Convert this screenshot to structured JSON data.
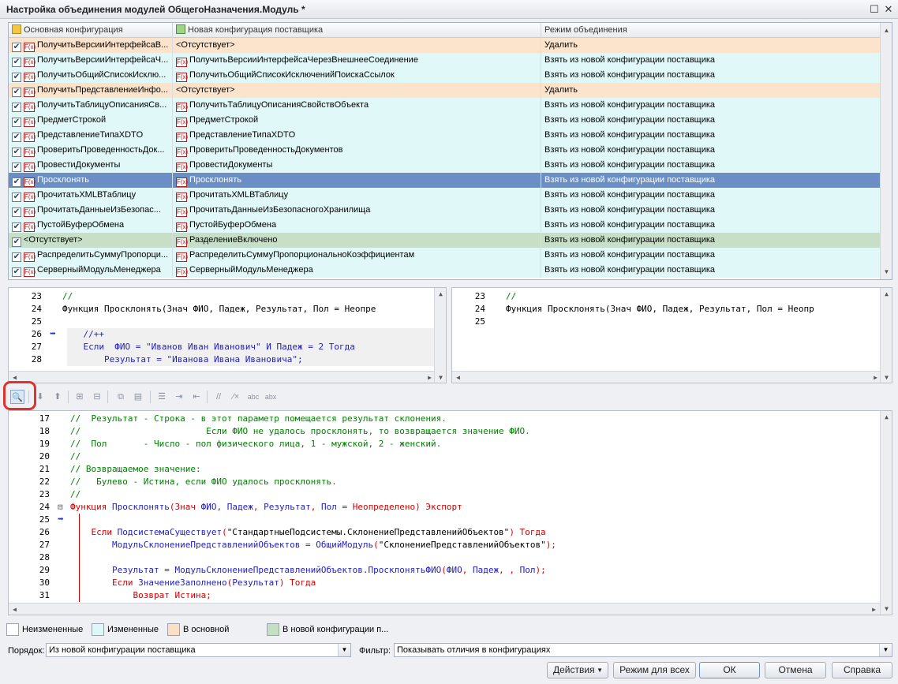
{
  "window": {
    "title": "Настройка объединения модулей ОбщегоНазначения.Модуль *",
    "maximize_glyph": "☐",
    "close_glyph": "✕"
  },
  "grid": {
    "columns": [
      "Основная конфигурация",
      "Новая конфигурация поставщика",
      "Режим объединения"
    ],
    "rows": [
      {
        "main": "ПолучитьВерсииИнтерфейсаВ...",
        "main_fx": true,
        "new": "<Отсутствует>",
        "new_fx": false,
        "mode": "Удалить",
        "state": "main"
      },
      {
        "main": "ПолучитьВерсииИнтерфейсаЧ...",
        "main_fx": true,
        "new": "ПолучитьВерсииИнтерфейсаЧерезВнешнееСоединение",
        "new_fx": true,
        "mode": "Взять из новой конфигурации поставщика",
        "state": "changed"
      },
      {
        "main": "ПолучитьОбщийСписокИсклю...",
        "main_fx": true,
        "new": "ПолучитьОбщийСписокИсключенийПоискаСсылок",
        "new_fx": true,
        "mode": "Взять из новой конфигурации поставщика",
        "state": "changed"
      },
      {
        "main": "ПолучитьПредставлениеИнфо...",
        "main_fx": true,
        "new": "<Отсутствует>",
        "new_fx": false,
        "mode": "Удалить",
        "state": "main"
      },
      {
        "main": "ПолучитьТаблицуОписанияСв...",
        "main_fx": true,
        "new": "ПолучитьТаблицуОписанияСвойствОбъекта",
        "new_fx": true,
        "mode": "Взять из новой конфигурации поставщика",
        "state": "changed"
      },
      {
        "main": "ПредметСтрокой",
        "main_fx": true,
        "new": "ПредметСтрокой",
        "new_fx": true,
        "mode": "Взять из новой конфигурации поставщика",
        "state": "changed"
      },
      {
        "main": "ПредставлениеТипаXDTO",
        "main_fx": true,
        "new": "ПредставлениеТипаXDTO",
        "new_fx": true,
        "mode": "Взять из новой конфигурации поставщика",
        "state": "changed"
      },
      {
        "main": "ПроверитьПроведенностьДок...",
        "main_fx": true,
        "new": "ПроверитьПроведенностьДокументов",
        "new_fx": true,
        "mode": "Взять из новой конфигурации поставщика",
        "state": "changed"
      },
      {
        "main": "ПровестиДокументы",
        "main_fx": true,
        "new": "ПровестиДокументы",
        "new_fx": true,
        "mode": "Взять из новой конфигурации поставщика",
        "state": "changed"
      },
      {
        "main": "Просклонять",
        "main_fx": true,
        "new": "Просклонять",
        "new_fx": true,
        "mode": "Взять из новой конфигурации поставщика",
        "state": "selected"
      },
      {
        "main": "ПрочитатьXMLВТаблицу",
        "main_fx": true,
        "new": "ПрочитатьXMLВТаблицу",
        "new_fx": true,
        "mode": "Взять из новой конфигурации поставщика",
        "state": "changed"
      },
      {
        "main": "ПрочитатьДанныеИзБезопас...",
        "main_fx": true,
        "new": "ПрочитатьДанныеИзБезопасногоХранилища",
        "new_fx": true,
        "mode": "Взять из новой конфигурации поставщика",
        "state": "changed"
      },
      {
        "main": "ПустойБуферОбмена",
        "main_fx": true,
        "new": "ПустойБуферОбмена",
        "new_fx": true,
        "mode": "Взять из новой конфигурации поставщика",
        "state": "changed"
      },
      {
        "main": "<Отсутствует>",
        "main_fx": false,
        "new": "РазделениеВключено",
        "new_fx": true,
        "mode": "Взять из новой конфигурации поставщика",
        "state": "new"
      },
      {
        "main": "РаспределитьСуммуПропорци...",
        "main_fx": true,
        "new": "РаспределитьСуммуПропорциональноКоэффициентам",
        "new_fx": true,
        "mode": "Взять из новой конфигурации поставщика",
        "state": "changed"
      },
      {
        "main": "СерверныйМодульМенеджера",
        "main_fx": true,
        "new": "СерверныйМодульМенеджера",
        "new_fx": true,
        "mode": "Взять из новой конфигурации поставщика",
        "state": "changed"
      }
    ]
  },
  "left_pane": [
    {
      "n": "23",
      "parts": [
        {
          "t": "//",
          "c": "cm"
        }
      ]
    },
    {
      "n": "24",
      "parts": [
        {
          "t": "Функция Просклонять(Знач ФИО, Падеж, Результат, Пол = Неопре",
          "c": "st"
        }
      ]
    },
    {
      "n": "25",
      "parts": []
    },
    {
      "n": "26",
      "parts": [
        {
          "t": "    //++",
          "c": "bl"
        }
      ],
      "arrow": true
    },
    {
      "n": "27",
      "parts": [
        {
          "t": "    Если  ФИО = \"Иванов Иван Иванович\" И Падеж = 2 Тогда",
          "c": "bl"
        }
      ]
    },
    {
      "n": "28",
      "parts": [
        {
          "t": "        Результат = \"Иванова Ивана Ивановича\";",
          "c": "bl"
        }
      ]
    }
  ],
  "right_pane": [
    {
      "n": "23",
      "parts": [
        {
          "t": "//",
          "c": "cm"
        }
      ]
    },
    {
      "n": "24",
      "parts": [
        {
          "t": "Функция Просклонять(Знач ФИО, Падеж, Результат, Пол = Неопр",
          "c": "st"
        }
      ]
    },
    {
      "n": "25",
      "parts": []
    }
  ],
  "code": [
    {
      "n": "17",
      "parts": [
        {
          "t": "//  Результат - Строка - в этот параметр помещается результат склонения.",
          "c": "cm"
        }
      ]
    },
    {
      "n": "18",
      "parts": [
        {
          "t": "//                        Если ФИО не удалось просклонять, то возвращается значение ФИО.",
          "c": "cm"
        }
      ]
    },
    {
      "n": "19",
      "parts": [
        {
          "t": "//  Пол       - Число - пол физического лица, 1 - мужской, 2 - женский.",
          "c": "cm"
        }
      ]
    },
    {
      "n": "20",
      "parts": [
        {
          "t": "//",
          "c": "cm"
        }
      ]
    },
    {
      "n": "21",
      "parts": [
        {
          "t": "// Возвращаемое значение:",
          "c": "cm"
        }
      ]
    },
    {
      "n": "22",
      "parts": [
        {
          "t": "//   Булево - Истина, если ФИО удалось просклонять.",
          "c": "cm"
        }
      ]
    },
    {
      "n": "23",
      "parts": [
        {
          "t": "//",
          "c": "cm"
        }
      ]
    },
    {
      "n": "24",
      "fold": true,
      "parts": [
        {
          "t": "Функция ",
          "c": "kw"
        },
        {
          "t": "Просклонять",
          "c": "bl"
        },
        {
          "t": "(",
          "c": "kw"
        },
        {
          "t": "Знач ",
          "c": "kw"
        },
        {
          "t": "ФИО",
          "c": "bl"
        },
        {
          "t": ", ",
          "c": "kw"
        },
        {
          "t": "Падеж",
          "c": "bl"
        },
        {
          "t": ", ",
          "c": "kw"
        },
        {
          "t": "Результат",
          "c": "bl"
        },
        {
          "t": ", ",
          "c": "kw"
        },
        {
          "t": "Пол",
          "c": "bl"
        },
        {
          "t": " = Неопределено) Экспорт",
          "c": "kw"
        }
      ]
    },
    {
      "n": "25",
      "arrow": true,
      "parts": []
    },
    {
      "n": "26",
      "parts": [
        {
          "t": "    Если ",
          "c": "kw"
        },
        {
          "t": "ПодсистемаСуществует",
          "c": "bl"
        },
        {
          "t": "(",
          "c": "kw"
        },
        {
          "t": "\"СтандартныеПодсистемы.СклонениеПредставленийОбъектов\"",
          "c": "st"
        },
        {
          "t": ") Тогда",
          "c": "kw"
        }
      ]
    },
    {
      "n": "27",
      "parts": [
        {
          "t": "        МодульСклонениеПредставленийОбъектов",
          "c": "bl"
        },
        {
          "t": " = ",
          "c": "kw"
        },
        {
          "t": "ОбщийМодуль",
          "c": "bl"
        },
        {
          "t": "(",
          "c": "kw"
        },
        {
          "t": "\"СклонениеПредставленийОбъектов\"",
          "c": "st"
        },
        {
          "t": ");",
          "c": "kw"
        }
      ]
    },
    {
      "n": "28",
      "parts": []
    },
    {
      "n": "29",
      "parts": [
        {
          "t": "        Результат",
          "c": "bl"
        },
        {
          "t": " = ",
          "c": "kw"
        },
        {
          "t": "МодульСклонениеПредставленийОбъектов.ПросклонятьФИО",
          "c": "bl"
        },
        {
          "t": "(",
          "c": "kw"
        },
        {
          "t": "ФИО",
          "c": "bl"
        },
        {
          "t": ", ",
          "c": "kw"
        },
        {
          "t": "Падеж",
          "c": "bl"
        },
        {
          "t": ", , ",
          "c": "kw"
        },
        {
          "t": "Пол",
          "c": "bl"
        },
        {
          "t": ");",
          "c": "kw"
        }
      ]
    },
    {
      "n": "30",
      "parts": [
        {
          "t": "        Если ",
          "c": "kw"
        },
        {
          "t": "ЗначениеЗаполнено",
          "c": "bl"
        },
        {
          "t": "(",
          "c": "kw"
        },
        {
          "t": "Результат",
          "c": "bl"
        },
        {
          "t": ") Тогда",
          "c": "kw"
        }
      ]
    },
    {
      "n": "31",
      "parts": [
        {
          "t": "            Возврат Истина;",
          "c": "kw"
        }
      ]
    }
  ],
  "legend": [
    {
      "label": "Неизмененные",
      "color": "#ffffff"
    },
    {
      "label": "Измененные",
      "color": "#dff7f7"
    },
    {
      "label": "В основной",
      "color": "#fbdfc6"
    },
    {
      "label": "В новой конфигурации п...",
      "color": "#c5dfc5"
    }
  ],
  "order": {
    "label": "Порядок:",
    "value": "Из новой конфигурации поставщика"
  },
  "filter": {
    "label": "Фильтр:",
    "value": "Показывать отличия в конфигурациях"
  },
  "buttons": {
    "actions": "Действия",
    "mode_all": "Режим для всех",
    "ok": "ОК",
    "cancel": "Отмена",
    "help": "Справка"
  },
  "colors": {
    "changed": "#e0f8f8",
    "main": "#fce3cb",
    "new": "#c7dfc6",
    "selected": "#6b8fc4",
    "highlight": "#e03030"
  }
}
